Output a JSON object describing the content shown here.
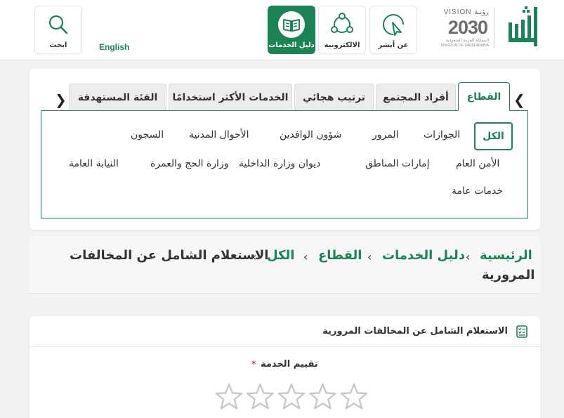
{
  "header": {
    "brand": "أبشر",
    "vision": {
      "line1": "VISION رؤيـة",
      "year": "2030",
      "line3": "المملكة العربية السعودية",
      "line4": "KINGDOM OF SAUDI ARABIA"
    },
    "buttons": [
      {
        "label": "عن أبشر",
        "icon": "cursor-click-icon",
        "active": false
      },
      {
        "label": "الالكترونية",
        "icon": "network-icon",
        "active": false
      },
      {
        "label": "دليل الخدمات",
        "icon": "book-icon",
        "active": true
      },
      {
        "label": "ابحث",
        "icon": "search-icon",
        "active": false
      }
    ],
    "language": "English"
  },
  "filters": {
    "tabs": [
      "القطاع",
      "أفراد المجتمع",
      "ترتيب هجائي",
      "الخدمات الأكثر استخدامًا",
      "الفئة المستهدفة"
    ],
    "active_tab": "القطاع",
    "chips": [
      "الكل",
      "الجوازات",
      "المرور",
      "شؤون الوافدين",
      "الأحوال المدنية",
      "السجون",
      "الأمن العام",
      "إمارات المناطق",
      "ديوان وزارة الداخلية",
      "وزارة الحج والعمرة",
      "النيابة العامة",
      "خدمات عامة"
    ],
    "selected_chip": "الكل"
  },
  "breadcrumb": {
    "items": [
      "الرئيسية",
      "دليل الخدمات",
      "القطاع",
      "الكل"
    ],
    "current_line1": "الاستعلام الشامل عن المخالفات",
    "current_line2": "المرورية"
  },
  "service": {
    "title": "الاستعلام الشامل عن المخالفات المرورية",
    "rating_label": "تقييم الخدمة",
    "required_mark": "*",
    "rating": 0,
    "max_rating": 5
  },
  "colors": {
    "accent": "#1b8354",
    "required": "#d0021b"
  }
}
